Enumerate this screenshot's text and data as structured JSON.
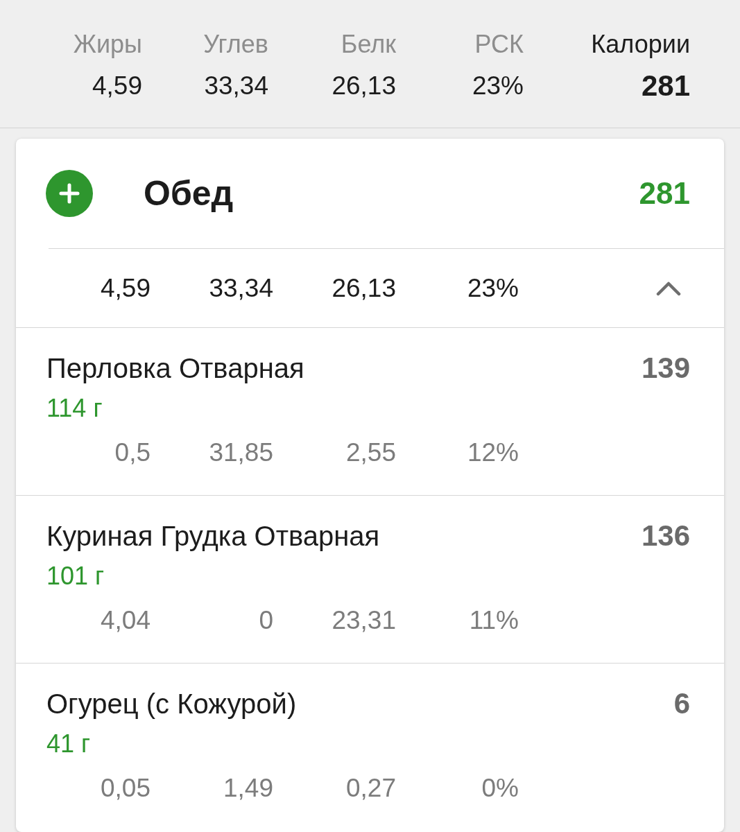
{
  "summary": {
    "columns": [
      {
        "kind": "macro",
        "label": "Жиры",
        "value": "4,59"
      },
      {
        "kind": "macro",
        "label": "Углев",
        "value": "33,34"
      },
      {
        "kind": "macro",
        "label": "Белк",
        "value": "26,13"
      },
      {
        "kind": "macro",
        "label": "РСК",
        "value": "23%"
      },
      {
        "kind": "total",
        "label": "Калории",
        "value": "281"
      }
    ]
  },
  "meal": {
    "title": "Обед",
    "calories": "281",
    "expanded": true,
    "totals": [
      "4,59",
      "33,34",
      "26,13",
      "23%"
    ],
    "items": [
      {
        "name": "Перловка Отварная",
        "weight": "114 г",
        "calories": "139",
        "macros": [
          "0,5",
          "31,85",
          "2,55",
          "12%"
        ]
      },
      {
        "name": "Куриная Грудка Отварная",
        "weight": "101 г",
        "calories": "136",
        "macros": [
          "4,04",
          "0",
          "23,31",
          "11%"
        ]
      },
      {
        "name": "Огурец (с Кожурой)",
        "weight": "41 г",
        "calories": "6",
        "macros": [
          "0,05",
          "1,49",
          "0,27",
          "0%"
        ]
      }
    ]
  }
}
